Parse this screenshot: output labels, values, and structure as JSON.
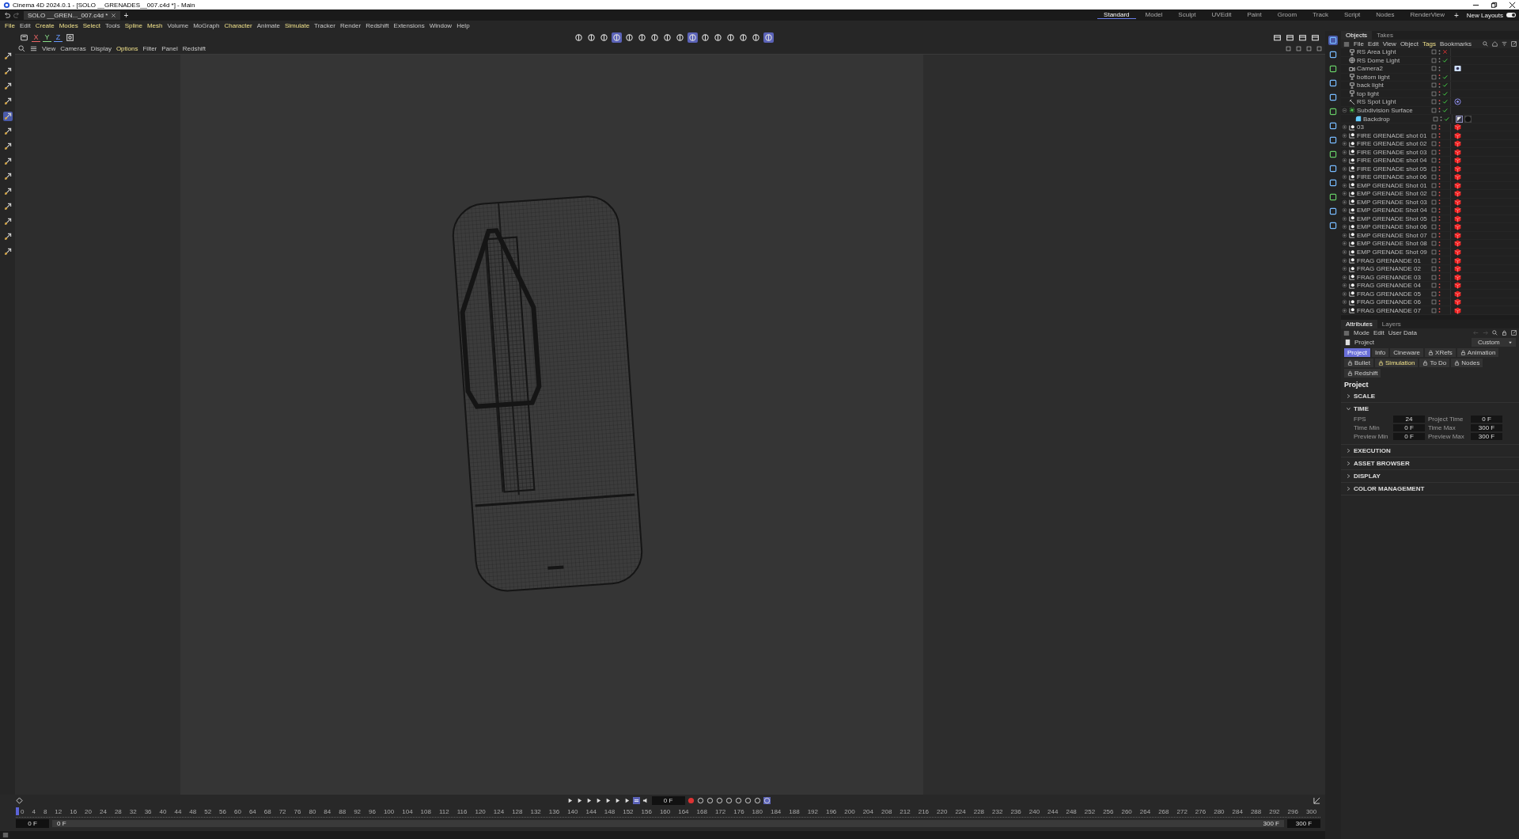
{
  "window": {
    "title": "Cinema 4D 2024.0.1 - [SOLO __GRENADES__007.c4d *] - Main"
  },
  "document_tab": {
    "label": "SOLO __GREN..._007.c4d *",
    "add": "+"
  },
  "layouts": [
    {
      "label": "Standard",
      "selected": true
    },
    {
      "label": "Model",
      "selected": false
    },
    {
      "label": "Sculpt",
      "selected": false
    },
    {
      "label": "UVEdit",
      "selected": false
    },
    {
      "label": "Paint",
      "selected": false
    },
    {
      "label": "Groom",
      "selected": false
    },
    {
      "label": "Track",
      "selected": false
    },
    {
      "label": "Script",
      "selected": false
    },
    {
      "label": "Nodes",
      "selected": false
    },
    {
      "label": "RenderView",
      "selected": false
    }
  ],
  "layout_add": "+",
  "new_layouts": {
    "label": "New Layouts",
    "on": true
  },
  "menu": [
    {
      "label": "File",
      "accent": true
    },
    {
      "label": "Edit",
      "accent": false
    },
    {
      "label": "Create",
      "accent": true
    },
    {
      "label": "Modes",
      "accent": true
    },
    {
      "label": "Select",
      "accent": true
    },
    {
      "label": "Tools",
      "accent": false
    },
    {
      "label": "Spline",
      "accent": true
    },
    {
      "label": "Mesh",
      "accent": true
    },
    {
      "label": "Volume",
      "accent": false
    },
    {
      "label": "MoGraph",
      "accent": false
    },
    {
      "label": "Character",
      "accent": true
    },
    {
      "label": "Animate",
      "accent": false
    },
    {
      "label": "Simulate",
      "accent": true
    },
    {
      "label": "Tracker",
      "accent": false
    },
    {
      "label": "Render",
      "accent": false
    },
    {
      "label": "Redshift",
      "accent": false
    },
    {
      "label": "Extensions",
      "accent": false
    },
    {
      "label": "Window",
      "accent": false
    },
    {
      "label": "Help",
      "accent": false
    }
  ],
  "axes": [
    "X",
    "Y",
    "Z"
  ],
  "viewport_menu": [
    {
      "label": "View",
      "accent": false
    },
    {
      "label": "Cameras",
      "accent": false
    },
    {
      "label": "Display",
      "accent": false
    },
    {
      "label": "Options",
      "accent": true
    },
    {
      "label": "Filter",
      "accent": false
    },
    {
      "label": "Panel",
      "accent": false
    },
    {
      "label": "Redshift",
      "accent": false
    }
  ],
  "objects_panel": {
    "tabs": [
      {
        "label": "Objects",
        "selected": true
      },
      {
        "label": "Takes",
        "selected": false
      }
    ],
    "menu": [
      {
        "label": "File",
        "accent": false
      },
      {
        "label": "Edit",
        "accent": false
      },
      {
        "label": "View",
        "accent": false
      },
      {
        "label": "Object",
        "accent": false
      },
      {
        "label": "Tags",
        "accent": true
      },
      {
        "label": "Bookmarks",
        "accent": false
      }
    ],
    "items": [
      {
        "name": "RS Area Light",
        "kind": "light",
        "enabled": false
      },
      {
        "name": "RS Dome Light",
        "kind": "dome",
        "enabled": true
      },
      {
        "name": "Camera2",
        "kind": "camera",
        "tags": [
          {
            "kind": "camera"
          }
        ]
      },
      {
        "name": "bottom light",
        "kind": "light",
        "enabled": true
      },
      {
        "name": "back light",
        "kind": "light",
        "enabled": true
      },
      {
        "name": "top light",
        "kind": "light",
        "enabled": true
      },
      {
        "name": "RS Spot Light",
        "kind": "spot",
        "enabled": true,
        "tags": [
          {
            "kind": "target"
          }
        ]
      },
      {
        "name": "Subdivision Surface",
        "kind": "subdivision",
        "enabled": true,
        "expanded": true,
        "children": [
          {
            "name": "Backdrop",
            "kind": "backdrop",
            "enabled": true,
            "tags": [
              {
                "kind": "phong"
              },
              {
                "kind": "material"
              }
            ]
          }
        ]
      },
      {
        "name": "03",
        "kind": "group",
        "expanded": false,
        "tags": [
          {
            "kind": "cube"
          }
        ]
      },
      {
        "name": "FIRE GRENADE shot 01",
        "kind": "group",
        "expanded": false,
        "tags": [
          {
            "kind": "cube"
          }
        ]
      },
      {
        "name": "FIRE GRENADE shot 02",
        "kind": "group",
        "expanded": false,
        "tags": [
          {
            "kind": "cube"
          }
        ]
      },
      {
        "name": "FIRE GRENADE shot 03",
        "kind": "group",
        "expanded": false,
        "tags": [
          {
            "kind": "cube"
          }
        ]
      },
      {
        "name": "FIRE GRENADE shot 04",
        "kind": "group",
        "expanded": false,
        "tags": [
          {
            "kind": "cube"
          }
        ]
      },
      {
        "name": "FIRE GRENADE shot 05",
        "kind": "group",
        "expanded": false,
        "tags": [
          {
            "kind": "cube"
          }
        ]
      },
      {
        "name": "FIRE GRENADE shot 06",
        "kind": "group",
        "expanded": false,
        "tags": [
          {
            "kind": "cube"
          }
        ]
      },
      {
        "name": "EMP GRENADE Shot 01",
        "kind": "group",
        "expanded": false,
        "tags": [
          {
            "kind": "cube"
          }
        ]
      },
      {
        "name": "EMP GRENADE Shot 02",
        "kind": "group",
        "expanded": false,
        "tags": [
          {
            "kind": "cube"
          }
        ]
      },
      {
        "name": "EMP GRENADE Shot 03",
        "kind": "group",
        "expanded": false,
        "tags": [
          {
            "kind": "cube"
          }
        ]
      },
      {
        "name": "EMP GRENADE Shot 04",
        "kind": "group",
        "expanded": false,
        "tags": [
          {
            "kind": "cube"
          }
        ]
      },
      {
        "name": "EMP GRENADE Shot 05",
        "kind": "group",
        "expanded": false,
        "tags": [
          {
            "kind": "cube"
          }
        ]
      },
      {
        "name": "EMP GRENADE Shot 06",
        "kind": "group",
        "expanded": false,
        "tags": [
          {
            "kind": "cube"
          }
        ]
      },
      {
        "name": "EMP GRENADE Shot 07",
        "kind": "group",
        "expanded": false,
        "tags": [
          {
            "kind": "cube"
          }
        ]
      },
      {
        "name": "EMP GRENADE Shot 08",
        "kind": "group",
        "expanded": false,
        "tags": [
          {
            "kind": "cube"
          }
        ]
      },
      {
        "name": "EMP GRENADE Shot 09",
        "kind": "group",
        "expanded": false,
        "tags": [
          {
            "kind": "cube"
          }
        ]
      },
      {
        "name": "FRAG GRENANDE 01",
        "kind": "group",
        "expanded": false,
        "tags": [
          {
            "kind": "cube"
          }
        ]
      },
      {
        "name": "FRAG GRENANDE 02",
        "kind": "group",
        "expanded": false,
        "tags": [
          {
            "kind": "cube"
          }
        ]
      },
      {
        "name": "FRAG GRENANDE 03",
        "kind": "group",
        "expanded": false,
        "tags": [
          {
            "kind": "cube"
          }
        ]
      },
      {
        "name": "FRAG GRENANDE 04",
        "kind": "group",
        "expanded": false,
        "tags": [
          {
            "kind": "cube"
          }
        ]
      },
      {
        "name": "FRAG GRENANDE 05",
        "kind": "group",
        "expanded": false,
        "tags": [
          {
            "kind": "cube"
          }
        ]
      },
      {
        "name": "FRAG GRENANDE 06",
        "kind": "group",
        "expanded": false,
        "tags": [
          {
            "kind": "cube"
          }
        ]
      },
      {
        "name": "FRAG GRENANDE 07",
        "kind": "group",
        "expanded": false,
        "tags": [
          {
            "kind": "cube"
          }
        ]
      }
    ]
  },
  "attributes_panel": {
    "tabs": [
      {
        "label": "Attributes",
        "selected": true
      },
      {
        "label": "Layers",
        "selected": false
      }
    ],
    "menu": [
      "Mode",
      "Edit",
      "User Data"
    ],
    "object": "Project",
    "preset": "Custom",
    "buttons": [
      {
        "label": "Project",
        "locked": false,
        "selected": true,
        "accent": false
      },
      {
        "label": "Info",
        "locked": false,
        "selected": false,
        "accent": false
      },
      {
        "label": "Cineware",
        "locked": false,
        "selected": false,
        "accent": false
      },
      {
        "label": "XRefs",
        "locked": true,
        "selected": false,
        "accent": false
      },
      {
        "label": "Animation",
        "locked": true,
        "selected": false,
        "accent": false
      },
      {
        "label": "Bullet",
        "locked": true,
        "selected": false,
        "accent": false
      },
      {
        "label": "Simulation",
        "locked": true,
        "selected": false,
        "accent": true
      },
      {
        "label": "To Do",
        "locked": true,
        "selected": false,
        "accent": false
      },
      {
        "label": "Nodes",
        "locked": true,
        "selected": false,
        "accent": false
      },
      {
        "label": "Redshift",
        "locked": true,
        "selected": false,
        "accent": false
      }
    ],
    "heading": "Project",
    "groups": [
      {
        "label": "SCALE",
        "expanded": false
      },
      {
        "label": "TIME",
        "expanded": true,
        "fields": [
          {
            "label": "FPS",
            "value": "24"
          },
          {
            "label": "Project Time",
            "value": "0 F"
          },
          {
            "label": "Time Min",
            "value": "0 F"
          },
          {
            "label": "Time Max",
            "value": "300 F"
          },
          {
            "label": "Preview Min",
            "value": "0 F"
          },
          {
            "label": "Preview Max",
            "value": "300 F"
          }
        ]
      },
      {
        "label": "EXECUTION",
        "expanded": false
      },
      {
        "label": "ASSET BROWSER",
        "expanded": false
      },
      {
        "label": "DISPLAY",
        "expanded": false
      },
      {
        "label": "COLOR MANAGEMENT",
        "expanded": false
      }
    ]
  },
  "timeline": {
    "current_frame": "0 F",
    "ruler": [
      "0",
      "4",
      "8",
      "12",
      "16",
      "20",
      "24",
      "28",
      "32",
      "36",
      "40",
      "44",
      "48",
      "52",
      "56",
      "60",
      "64",
      "68",
      "72",
      "76",
      "80",
      "84",
      "88",
      "92",
      "96",
      "100",
      "104",
      "108",
      "112",
      "116",
      "120",
      "124",
      "128",
      "132",
      "136",
      "140",
      "144",
      "148",
      "152",
      "156",
      "160",
      "164",
      "168",
      "172",
      "176",
      "180",
      "184",
      "188",
      "192",
      "196",
      "200",
      "204",
      "208",
      "212",
      "216",
      "220",
      "224",
      "228",
      "232",
      "236",
      "240",
      "244",
      "248",
      "252",
      "256",
      "260",
      "264",
      "268",
      "272",
      "276",
      "280",
      "284",
      "288",
      "292",
      "296",
      "300"
    ],
    "range_start": "0 F",
    "range_start_2": "0 F",
    "range_end": "300 F",
    "range_end_2": "300 F"
  }
}
